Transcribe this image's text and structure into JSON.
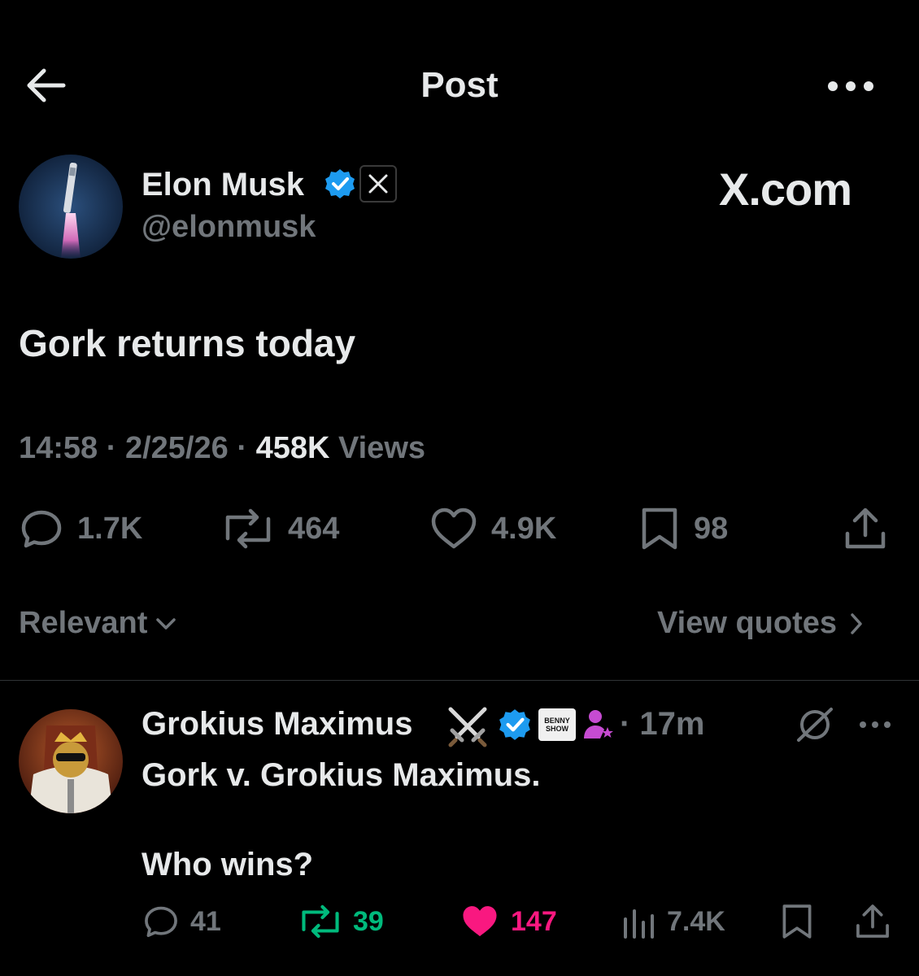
{
  "header": {
    "title": "Post"
  },
  "post": {
    "author_name": "Elon Musk",
    "handle": "@elonmusk",
    "brand": "X.com",
    "text": "Gork returns today",
    "time": "14:58",
    "date": "2/25/26",
    "views_count": "458K",
    "views_label": "Views",
    "separator": "·",
    "stats": {
      "replies": "1.7K",
      "reposts": "464",
      "likes": "4.9K",
      "bookmarks": "98"
    }
  },
  "sort": {
    "label": "Relevant",
    "quotes_label": "View quotes"
  },
  "reply": {
    "author_name": "Grokius Maximus",
    "time": "· 17m",
    "badge_text_1": "BENNY",
    "badge_text_2": "SHOW",
    "text_line1": "Gork v. Grokius Maximus.",
    "text_line2": "Who wins?",
    "stats": {
      "replies": "41",
      "reposts": "39",
      "likes": "147",
      "views": "7.4K"
    }
  },
  "colors": {
    "verified": "#1d9bf0",
    "repost_active": "#00ba7c",
    "like_active": "#f91880",
    "muted": "#71767b",
    "text": "#e7e9ea"
  }
}
